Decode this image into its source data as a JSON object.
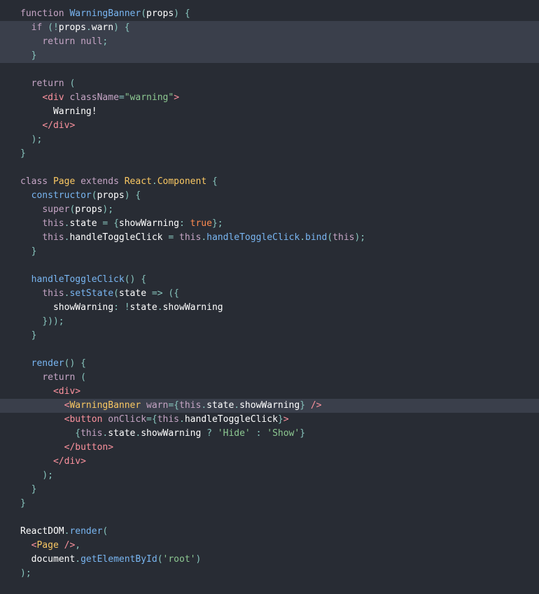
{
  "editor": {
    "background": "#282c34",
    "highlight": "#3a3f4b",
    "colors": {
      "kw": "#c5a5c5",
      "fn": "#79b6f2",
      "pl": "#ffffff",
      "pn": "#88c6be",
      "tg": "#fc929e",
      "at": "#c5a5c5",
      "st": "#8dc891",
      "cl": "#fac863",
      "bl": "#ff8b50"
    },
    "lines": [
      {
        "hl": false,
        "t": [
          [
            "kw",
            "function "
          ],
          [
            "fn",
            "WarningBanner"
          ],
          [
            "pn",
            "("
          ],
          [
            "pl",
            "props"
          ],
          [
            "pn",
            ") {"
          ]
        ]
      },
      {
        "hl": true,
        "t": [
          [
            "pl",
            "  "
          ],
          [
            "kw",
            "if "
          ],
          [
            "pn",
            "(!"
          ],
          [
            "pl",
            "props"
          ],
          [
            "pn",
            "."
          ],
          [
            "pl",
            "warn"
          ],
          [
            "pn",
            ") {"
          ]
        ]
      },
      {
        "hl": true,
        "t": [
          [
            "pl",
            "    "
          ],
          [
            "kw",
            "return "
          ],
          [
            "kw",
            "null"
          ],
          [
            "pn",
            ";"
          ]
        ]
      },
      {
        "hl": true,
        "t": [
          [
            "pl",
            "  "
          ],
          [
            "pn",
            "}"
          ]
        ]
      },
      {
        "hl": false,
        "t": []
      },
      {
        "hl": false,
        "t": [
          [
            "pl",
            "  "
          ],
          [
            "kw",
            "return "
          ],
          [
            "pn",
            "("
          ]
        ]
      },
      {
        "hl": false,
        "t": [
          [
            "pl",
            "    "
          ],
          [
            "tg",
            "<div "
          ],
          [
            "at",
            "className"
          ],
          [
            "pn",
            "="
          ],
          [
            "st",
            "\"warning\""
          ],
          [
            "tg",
            ">"
          ]
        ]
      },
      {
        "hl": false,
        "t": [
          [
            "pl",
            "      Warning!"
          ]
        ]
      },
      {
        "hl": false,
        "t": [
          [
            "pl",
            "    "
          ],
          [
            "tg",
            "</div>"
          ]
        ]
      },
      {
        "hl": false,
        "t": [
          [
            "pl",
            "  "
          ],
          [
            "pn",
            ");"
          ]
        ]
      },
      {
        "hl": false,
        "t": [
          [
            "pn",
            "}"
          ]
        ]
      },
      {
        "hl": false,
        "t": []
      },
      {
        "hl": false,
        "t": [
          [
            "kw",
            "class "
          ],
          [
            "cl",
            "Page "
          ],
          [
            "kw",
            "extends "
          ],
          [
            "cl",
            "React"
          ],
          [
            "pn",
            "."
          ],
          [
            "cl",
            "Component "
          ],
          [
            "pn",
            "{"
          ]
        ]
      },
      {
        "hl": false,
        "t": [
          [
            "pl",
            "  "
          ],
          [
            "fn",
            "constructor"
          ],
          [
            "pn",
            "("
          ],
          [
            "pl",
            "props"
          ],
          [
            "pn",
            ") {"
          ]
        ]
      },
      {
        "hl": false,
        "t": [
          [
            "pl",
            "    "
          ],
          [
            "kw",
            "super"
          ],
          [
            "pn",
            "("
          ],
          [
            "pl",
            "props"
          ],
          [
            "pn",
            ");"
          ]
        ]
      },
      {
        "hl": false,
        "t": [
          [
            "pl",
            "    "
          ],
          [
            "kw",
            "this"
          ],
          [
            "pn",
            "."
          ],
          [
            "pl",
            "state "
          ],
          [
            "pn",
            "= {"
          ],
          [
            "pl",
            "showWarning"
          ],
          [
            "pn",
            ": "
          ],
          [
            "bl",
            "true"
          ],
          [
            "pn",
            "};"
          ]
        ]
      },
      {
        "hl": false,
        "t": [
          [
            "pl",
            "    "
          ],
          [
            "kw",
            "this"
          ],
          [
            "pn",
            "."
          ],
          [
            "pl",
            "handleToggleClick "
          ],
          [
            "pn",
            "= "
          ],
          [
            "kw",
            "this"
          ],
          [
            "pn",
            "."
          ],
          [
            "fn",
            "handleToggleClick"
          ],
          [
            "pn",
            "."
          ],
          [
            "fn",
            "bind"
          ],
          [
            "pn",
            "("
          ],
          [
            "kw",
            "this"
          ],
          [
            "pn",
            ");"
          ]
        ]
      },
      {
        "hl": false,
        "t": [
          [
            "pl",
            "  "
          ],
          [
            "pn",
            "}"
          ]
        ]
      },
      {
        "hl": false,
        "t": []
      },
      {
        "hl": false,
        "t": [
          [
            "pl",
            "  "
          ],
          [
            "fn",
            "handleToggleClick"
          ],
          [
            "pn",
            "() {"
          ]
        ]
      },
      {
        "hl": false,
        "t": [
          [
            "pl",
            "    "
          ],
          [
            "kw",
            "this"
          ],
          [
            "pn",
            "."
          ],
          [
            "fn",
            "setState"
          ],
          [
            "pn",
            "("
          ],
          [
            "pl",
            "state "
          ],
          [
            "pn",
            "=> ({"
          ]
        ]
      },
      {
        "hl": false,
        "t": [
          [
            "pl",
            "      showWarning"
          ],
          [
            "pn",
            ": !"
          ],
          [
            "pl",
            "state"
          ],
          [
            "pn",
            "."
          ],
          [
            "pl",
            "showWarning"
          ]
        ]
      },
      {
        "hl": false,
        "t": [
          [
            "pl",
            "    "
          ],
          [
            "pn",
            "}));"
          ]
        ]
      },
      {
        "hl": false,
        "t": [
          [
            "pl",
            "  "
          ],
          [
            "pn",
            "}"
          ]
        ]
      },
      {
        "hl": false,
        "t": []
      },
      {
        "hl": false,
        "t": [
          [
            "pl",
            "  "
          ],
          [
            "fn",
            "render"
          ],
          [
            "pn",
            "() {"
          ]
        ]
      },
      {
        "hl": false,
        "t": [
          [
            "pl",
            "    "
          ],
          [
            "kw",
            "return "
          ],
          [
            "pn",
            "("
          ]
        ]
      },
      {
        "hl": false,
        "t": [
          [
            "pl",
            "      "
          ],
          [
            "tg",
            "<div>"
          ]
        ]
      },
      {
        "hl": true,
        "t": [
          [
            "pl",
            "        "
          ],
          [
            "tg",
            "<"
          ],
          [
            "cl",
            "WarningBanner "
          ],
          [
            "at",
            "warn"
          ],
          [
            "pn",
            "={"
          ],
          [
            "kw",
            "this"
          ],
          [
            "pn",
            "."
          ],
          [
            "pl",
            "state"
          ],
          [
            "pn",
            "."
          ],
          [
            "pl",
            "showWarning"
          ],
          [
            "pn",
            "} "
          ],
          [
            "tg",
            "/>"
          ]
        ]
      },
      {
        "hl": false,
        "t": [
          [
            "pl",
            "        "
          ],
          [
            "tg",
            "<button "
          ],
          [
            "at",
            "onClick"
          ],
          [
            "pn",
            "={"
          ],
          [
            "kw",
            "this"
          ],
          [
            "pn",
            "."
          ],
          [
            "pl",
            "handleToggleClick"
          ],
          [
            "pn",
            "}"
          ],
          [
            "tg",
            ">"
          ]
        ]
      },
      {
        "hl": false,
        "t": [
          [
            "pl",
            "          "
          ],
          [
            "pn",
            "{"
          ],
          [
            "kw",
            "this"
          ],
          [
            "pn",
            "."
          ],
          [
            "pl",
            "state"
          ],
          [
            "pn",
            "."
          ],
          [
            "pl",
            "showWarning "
          ],
          [
            "pn",
            "? "
          ],
          [
            "st",
            "'Hide' "
          ],
          [
            "pn",
            ": "
          ],
          [
            "st",
            "'Show'"
          ],
          [
            "pn",
            "}"
          ]
        ]
      },
      {
        "hl": false,
        "t": [
          [
            "pl",
            "        "
          ],
          [
            "tg",
            "</button>"
          ]
        ]
      },
      {
        "hl": false,
        "t": [
          [
            "pl",
            "      "
          ],
          [
            "tg",
            "</div>"
          ]
        ]
      },
      {
        "hl": false,
        "t": [
          [
            "pl",
            "    "
          ],
          [
            "pn",
            ");"
          ]
        ]
      },
      {
        "hl": false,
        "t": [
          [
            "pl",
            "  "
          ],
          [
            "pn",
            "}"
          ]
        ]
      },
      {
        "hl": false,
        "t": [
          [
            "pn",
            "}"
          ]
        ]
      },
      {
        "hl": false,
        "t": []
      },
      {
        "hl": false,
        "t": [
          [
            "pl",
            "ReactDOM"
          ],
          [
            "pn",
            "."
          ],
          [
            "fn",
            "render"
          ],
          [
            "pn",
            "("
          ]
        ]
      },
      {
        "hl": false,
        "t": [
          [
            "pl",
            "  "
          ],
          [
            "tg",
            "<"
          ],
          [
            "cl",
            "Page "
          ],
          [
            "tg",
            "/>"
          ],
          [
            "pn",
            ","
          ]
        ]
      },
      {
        "hl": false,
        "t": [
          [
            "pl",
            "  document"
          ],
          [
            "pn",
            "."
          ],
          [
            "fn",
            "getElementById"
          ],
          [
            "pn",
            "("
          ],
          [
            "st",
            "'root'"
          ],
          [
            "pn",
            ")"
          ]
        ]
      },
      {
        "hl": false,
        "t": [
          [
            "pn",
            ");"
          ]
        ]
      }
    ]
  }
}
